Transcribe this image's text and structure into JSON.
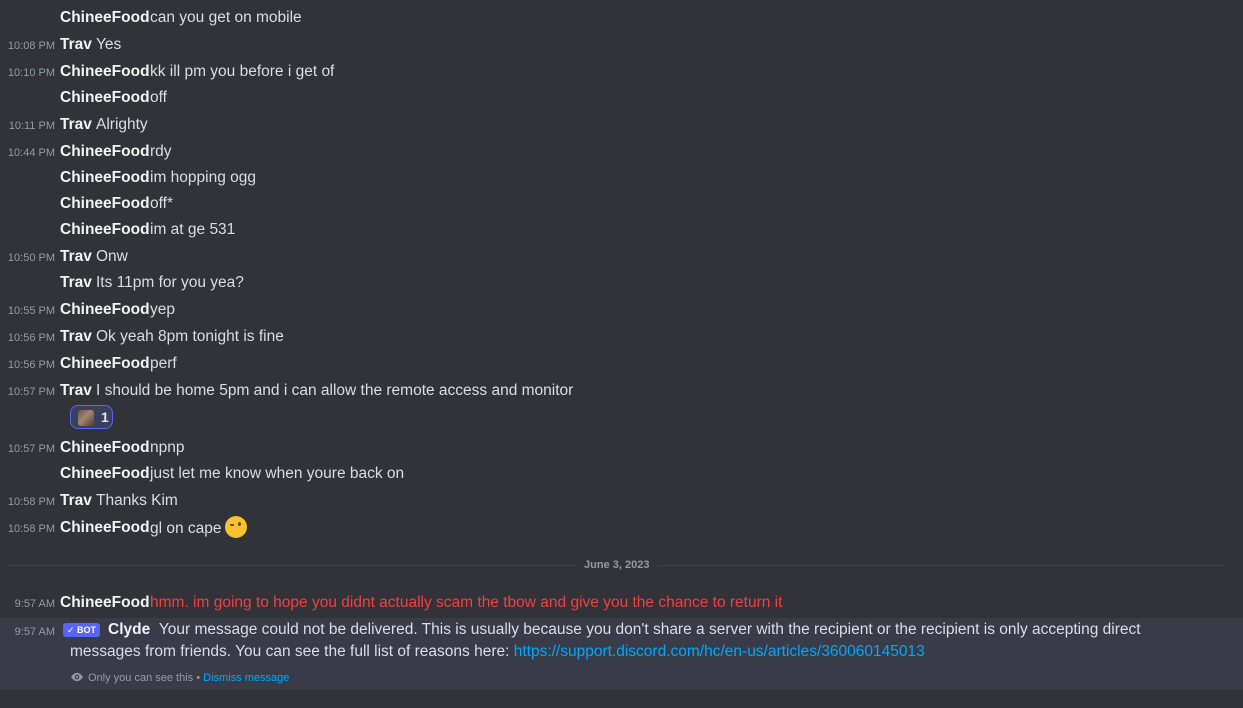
{
  "messages": [
    {
      "time": "",
      "author": "ChineeFood",
      "text": "can you get on mobile"
    },
    {
      "time": "10:08 PM",
      "author": "Trav",
      "text": "Yes"
    },
    {
      "time": "10:10 PM",
      "author": "ChineeFood",
      "text": "kk ill pm you before i get of"
    },
    {
      "time": "",
      "author": "ChineeFood",
      "text": "off"
    },
    {
      "time": "10:11 PM",
      "author": "Trav",
      "text": "Alrighty"
    },
    {
      "time": "10:44 PM",
      "author": "ChineeFood",
      "text": "rdy"
    },
    {
      "time": "",
      "author": "ChineeFood",
      "text": "im hopping ogg"
    },
    {
      "time": "",
      "author": "ChineeFood",
      "text": "off*"
    },
    {
      "time": "",
      "author": "ChineeFood",
      "text": "im at ge 531"
    },
    {
      "time": "10:50 PM",
      "author": "Trav",
      "text": "Onw"
    },
    {
      "time": "",
      "author": "Trav",
      "text": "Its 11pm for you yea?"
    },
    {
      "time": "10:55 PM",
      "author": "ChineeFood",
      "text": "yep"
    },
    {
      "time": "10:56 PM",
      "author": "Trav",
      "text": "Ok yeah 8pm tonight is fine"
    },
    {
      "time": "10:56 PM",
      "author": "ChineeFood",
      "text": "perf"
    },
    {
      "time": "10:57 PM",
      "author": "Trav",
      "text": "I should be home 5pm and i can allow the remote access and monitor"
    },
    {
      "time": "10:57 PM",
      "author": "ChineeFood",
      "text": "npnp"
    },
    {
      "time": "",
      "author": "ChineeFood",
      "text": "just let me know when youre back on"
    },
    {
      "time": "10:58 PM",
      "author": "Trav",
      "text": "Thanks Kim"
    },
    {
      "time": "10:58 PM",
      "author": "ChineeFood",
      "text": "gl on cape"
    }
  ],
  "reaction": {
    "count": "1"
  },
  "divider": {
    "date": "June 3, 2023"
  },
  "failed_message": {
    "time": "9:57 AM",
    "author": "ChineeFood",
    "text": "hmm. im going to hope you didnt actually scam the tbow and give you the chance to return it",
    "color": "#f23f42"
  },
  "clyde": {
    "time": "9:57 AM",
    "bot_tag": "✓ BOT",
    "author": "Clyde",
    "text": "Your message could not be delivered. This is usually because you don't share a server with the recipient or the recipient is only accepting direct messages from friends. You can see the full list of reasons here:",
    "link": "https://support.discord.com/hc/en-us/articles/360060145013",
    "only_you": "Only you can see this •",
    "dismiss": "Dismiss message"
  },
  "colors": {
    "background": "#313338",
    "link": "#00a8fc",
    "bot_tag": "#5865f2"
  }
}
